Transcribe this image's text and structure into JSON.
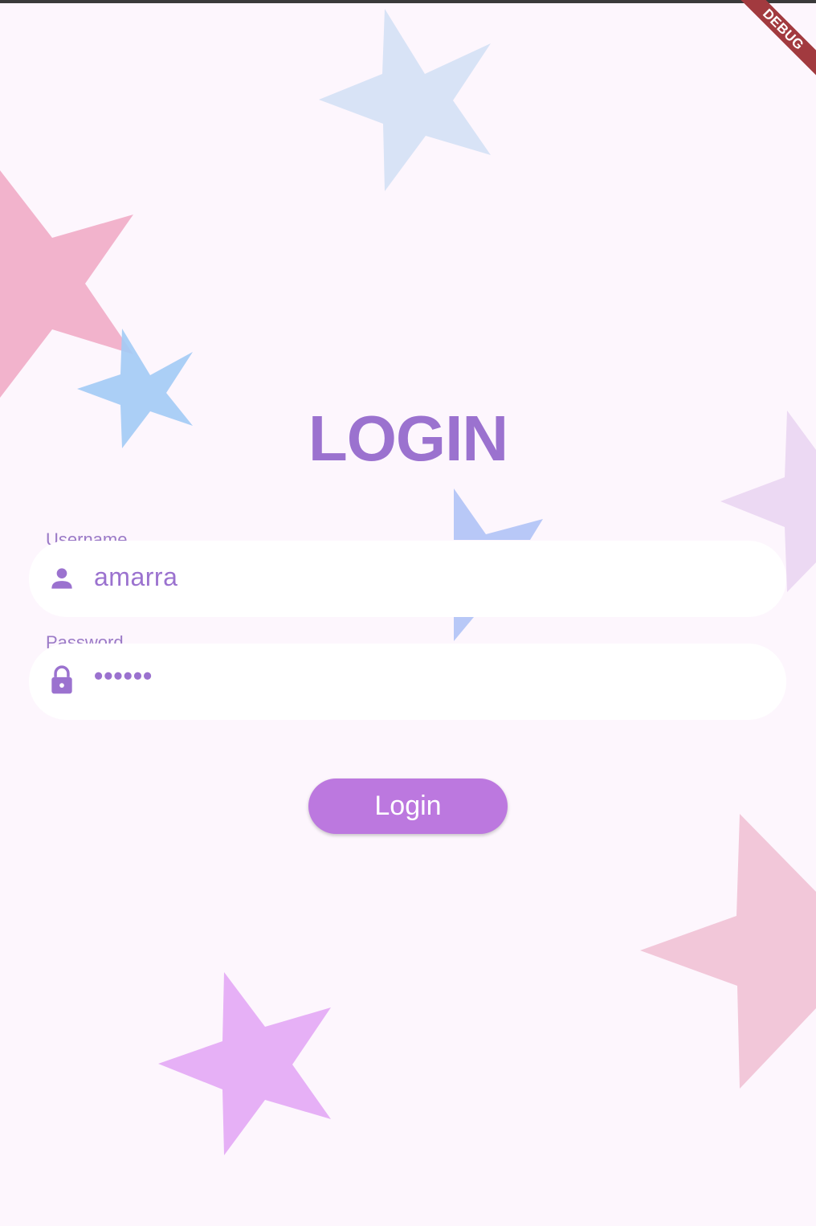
{
  "debug_banner": "DEBUG",
  "title": "LOGIN",
  "username": {
    "label": "Username",
    "value": "amarra",
    "icon": "person-icon"
  },
  "password": {
    "label": "Password",
    "value": "••••••",
    "icon": "lock-icon"
  },
  "login_button": "Login",
  "colors": {
    "background": "#fdf6fd",
    "accent": "#9b72cf",
    "button": "#bc78df",
    "field": "#ffffff",
    "debug": "#a23a3f"
  }
}
